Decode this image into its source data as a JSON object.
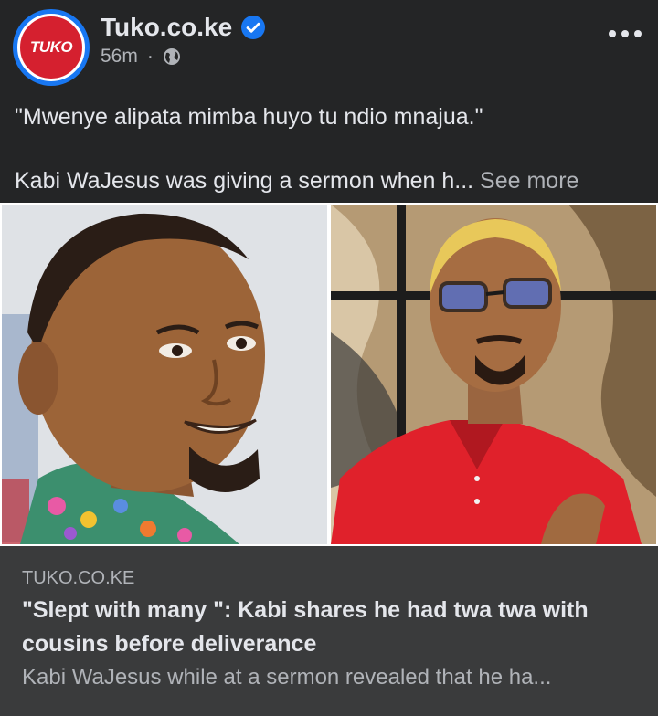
{
  "header": {
    "page_name": "Tuko.co.ke",
    "avatar_text": "TUKO",
    "time": "56m",
    "separator": "·",
    "privacy_icon": "globe-icon",
    "verified_icon": "verified-badge-icon",
    "more_icon": "more-options-icon"
  },
  "post": {
    "quote": "\"Mwenye alipata mimba huyo tu ndio mnajua.\"",
    "body": "Kabi WaJesus was giving a sermon when h...",
    "see_more": "See more"
  },
  "link": {
    "domain": "TUKO.CO.KE",
    "title": "\"Slept with many \": Kabi shares he had twa twa with cousins before deliverance",
    "description": "Kabi WaJesus while at a sermon revealed that he ha..."
  },
  "colors": {
    "background": "#242526",
    "link_card": "#3a3b3c",
    "brand_blue": "#1877f2",
    "tuko_red": "#d5202f"
  }
}
